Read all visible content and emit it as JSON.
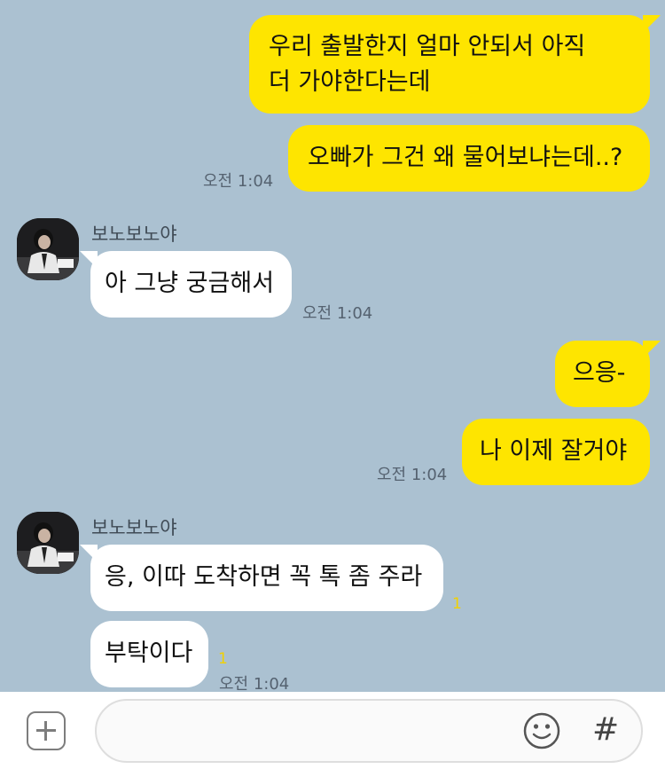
{
  "messages": {
    "m1_line1": "우리 출발한지 얼마 안되서 아직",
    "m1_line2": "더 가야한다는데",
    "m2": "오빠가 그건 왜 물어보냐는데..?",
    "t1": "오전 1:04",
    "sender1": "보노보노야",
    "m3": "아 그냥 궁금해서",
    "t2": "오전 1:04",
    "m4": "으응-",
    "m5": "나 이제 잘거야",
    "t3": "오전 1:04",
    "sender2": "보노보노야",
    "m6": "응, 이따 도착하면 꼭 톡 좀 주라",
    "m6_unread": "1",
    "m7": "부탁이다",
    "m7_unread": "1",
    "t4": "오전 1:04"
  },
  "input": {
    "placeholder": "",
    "hash_label": "#"
  },
  "icons": {
    "attach": "plus-icon",
    "emoji": "emoji-icon",
    "hash": "hash-icon"
  },
  "colors": {
    "background": "#abc1d1",
    "mine_bubble": "#fee500",
    "their_bubble": "#ffffff",
    "unread": "#f2d100"
  }
}
